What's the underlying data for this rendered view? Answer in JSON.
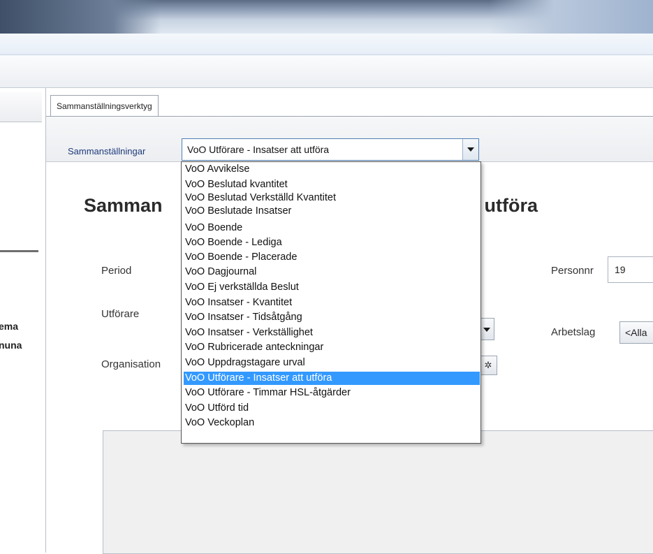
{
  "left_panel": {
    "lines": [
      "ema",
      "nuna"
    ]
  },
  "tab": {
    "label": "Sammanställningsverktyg"
  },
  "filter": {
    "label": "Sammanställningar",
    "selected": "VoO Utförare - Insatser att utföra"
  },
  "report": {
    "heading_left": "Samman",
    "heading_right": "t utföra",
    "period_label": "Period",
    "personnr_label": "Personnr",
    "personnr_value": "19",
    "utforare_label": "Utförare",
    "arbetslag_label": "Arbetslag",
    "arbetslag_value": "<Alla",
    "organisation_label": "Organisation"
  },
  "dropdown": {
    "options": [
      "VoO Avvikelse",
      "VoO Beslutad kvantitet",
      "VoO Beslutad Verkställd Kvantitet",
      "VoO Beslutade Insatser",
      "VoO Boende",
      "VoO Boende - Lediga",
      "VoO Boende - Placerade",
      "VoO Dagjournal",
      "VoO Ej verkställda Beslut",
      "VoO Insatser - Kvantitet",
      "VoO Insatser - Tidsåtgång",
      "VoO Insatser - Verkställighet",
      "VoO Rubricerade anteckningar",
      "VoO Uppdragstagare urval",
      "VoO Utförare - Insatser att utföra",
      "VoO Utförare - Timmar HSL-åtgärder",
      "VoO Utförd tid",
      "VoO Veckoplan"
    ],
    "selected_index": 14,
    "highlight_color": "#3399ff"
  }
}
